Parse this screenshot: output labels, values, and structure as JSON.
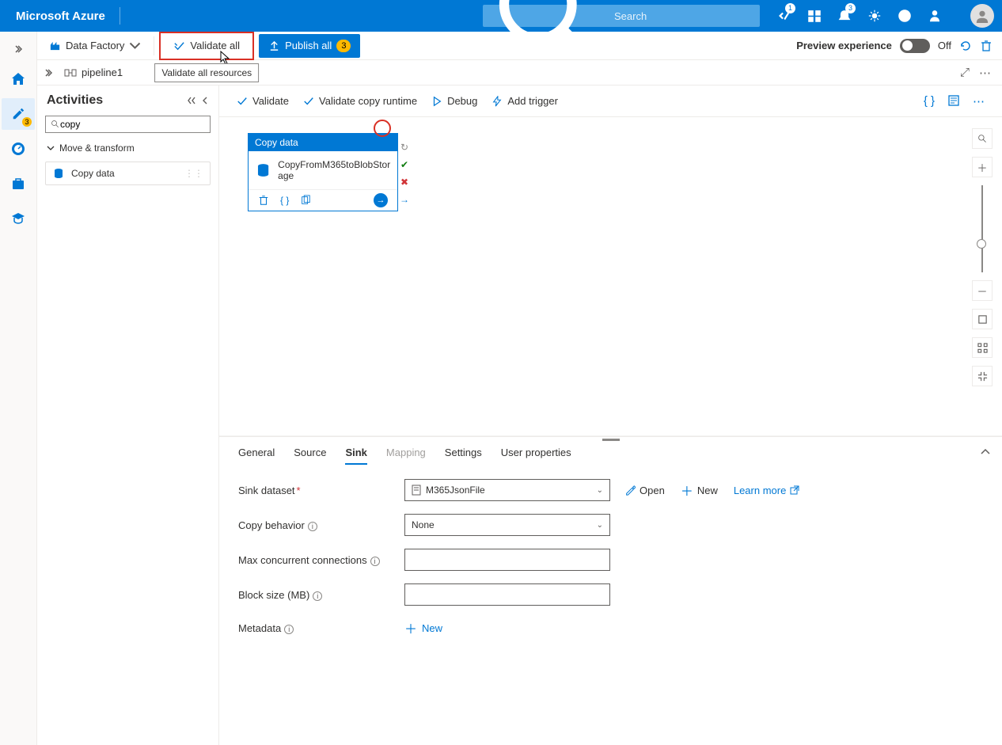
{
  "header": {
    "brand": "Microsoft Azure",
    "search_placeholder": "Search",
    "badge1": "1",
    "badge2": "3"
  },
  "toolbar": {
    "data_factory": "Data Factory",
    "validate_all": "Validate all",
    "validate_all_tooltip": "Validate all resources",
    "publish_all": "Publish all",
    "publish_count": "3",
    "preview_label": "Preview experience",
    "toggle_state": "Off"
  },
  "left_rail": {
    "badge": "3"
  },
  "breadcrumb": {
    "pipeline": "pipeline1"
  },
  "activities": {
    "title": "Activities",
    "search_value": "copy",
    "group": "Move & transform",
    "item1": "Copy data"
  },
  "canvas_toolbar": {
    "validate": "Validate",
    "validate_runtime": "Validate copy runtime",
    "debug": "Debug",
    "add_trigger": "Add trigger"
  },
  "node": {
    "title": "Copy data",
    "name": "CopyFromM365toBlobStorage"
  },
  "bottom_tabs": {
    "general": "General",
    "source": "Source",
    "sink": "Sink",
    "mapping": "Mapping",
    "settings": "Settings",
    "user_props": "User properties"
  },
  "form": {
    "sink_dataset_label": "Sink dataset",
    "sink_dataset_value": "M365JsonFile",
    "open": "Open",
    "new": "New",
    "learn_more": "Learn more",
    "copy_behavior_label": "Copy behavior",
    "copy_behavior_value": "None",
    "max_conn_label": "Max concurrent connections",
    "block_size_label": "Block size (MB)",
    "metadata_label": "Metadata",
    "metadata_new": "New"
  }
}
